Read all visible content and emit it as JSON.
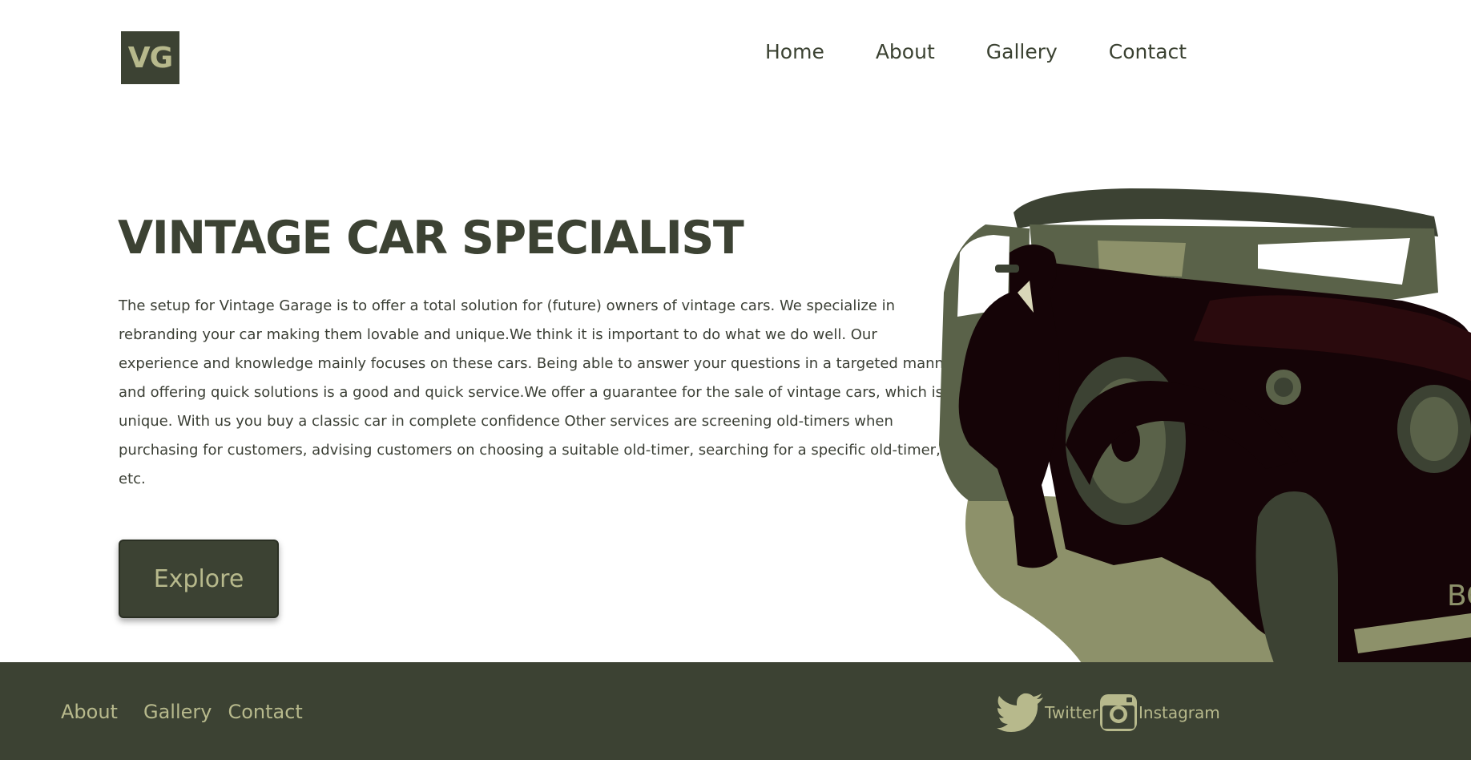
{
  "brand": {
    "logo_text": "VG"
  },
  "nav": {
    "items": [
      "Home",
      "About",
      "Gallery",
      "Contact"
    ]
  },
  "hero": {
    "title": "VINTAGE CAR SPECIALIST",
    "description": "The setup for Vintage Garage is to offer a total solution for (future) owners of vintage cars. We specialize in rebranding your car making them lovable and unique.We think it is important to do what we do well. Our experience and knowledge mainly focuses on these cars. Being able to answer your questions in a targeted manner and offering quick solutions is a good and quick service.We offer a guarantee for the sale of vintage cars, which is unique. With us you buy a classic car in complete confidence Other services are screening old-timers when purchasing for customers, advising customers on choosing a suitable old-timer, searching for a specific old-timer, etc.",
    "button_label": "Explore",
    "illustration_plate_text": "BG"
  },
  "footer": {
    "links": [
      "About",
      "Gallery",
      "Contact"
    ],
    "social": [
      {
        "label": "Twitter",
        "icon": "twitter-bird-icon"
      },
      {
        "label": "Instagram",
        "icon": "instagram-icon"
      }
    ]
  },
  "colors": {
    "primary_dark": "#3c4233",
    "accent": "#b7b98c",
    "illustration_dark": "#150407",
    "illustration_mid": "#5a6249",
    "illustration_light": "#8d916a"
  }
}
